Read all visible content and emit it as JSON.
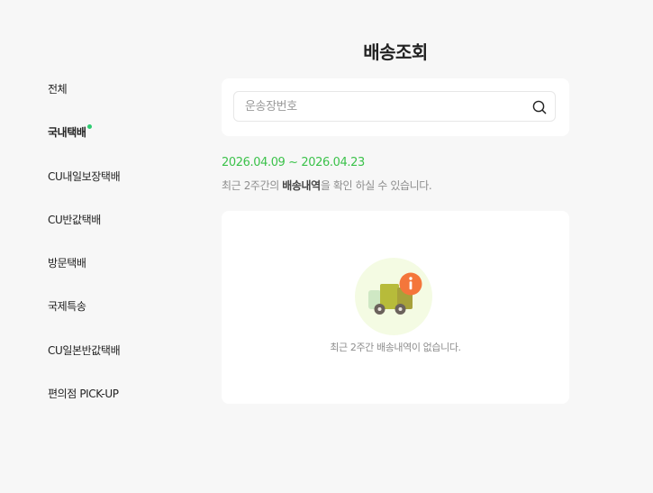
{
  "header": {
    "title": "배송조회"
  },
  "sidebar": {
    "items": [
      {
        "label": "전체"
      },
      {
        "label": "국내택배",
        "active": true
      },
      {
        "label": "CU내일보장택배"
      },
      {
        "label": "CU반값택배"
      },
      {
        "label": "방문택배"
      },
      {
        "label": "국제특송"
      },
      {
        "label": "CU일본반값택배"
      },
      {
        "label": "편의점 PICK-UP"
      }
    ]
  },
  "search": {
    "placeholder": "운송장번호",
    "value": "",
    "icon": "search-icon"
  },
  "period": {
    "range": "2026.04.09 ~ 2026.04.23",
    "desc_prefix": "최근 2주간의 ",
    "desc_bold": "배송내역",
    "desc_suffix": "을 확인 하실 수 있습니다."
  },
  "empty_state": {
    "icon": "delivery-truck-info-icon",
    "message": "최근 2주간 배송내역이 없습니다."
  },
  "colors": {
    "accent_green": "#3cc24b",
    "active_dot": "#2ecc71",
    "info_badge": "#f4763b",
    "background": "#f7f7f7"
  }
}
